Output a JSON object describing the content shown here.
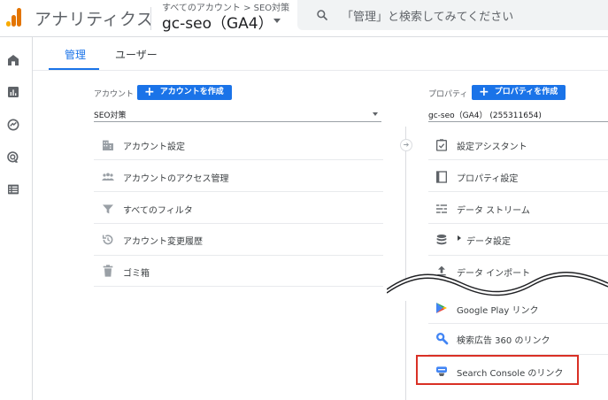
{
  "header": {
    "app_title": "アナリティクス",
    "breadcrumb": "すべてのアカウント > SEO対策",
    "property_title": "gc-seo（GA4）",
    "search_placeholder": "「管理」と検索してみてください"
  },
  "rail": {
    "items": [
      {
        "icon": "home-icon"
      },
      {
        "icon": "reports-icon"
      },
      {
        "icon": "explore-icon"
      },
      {
        "icon": "advertising-icon"
      },
      {
        "icon": "configure-icon"
      }
    ]
  },
  "tabs": [
    {
      "label": "管理",
      "active": true
    },
    {
      "label": "ユーザー",
      "active": false
    }
  ],
  "account": {
    "label": "アカウント",
    "create_button": "アカウントを作成",
    "selected": "SEO対策",
    "items": [
      {
        "label": "アカウント設定",
        "icon": "building-icon"
      },
      {
        "label": "アカウントのアクセス管理",
        "icon": "people-icon"
      },
      {
        "label": "すべてのフィルタ",
        "icon": "filter-icon"
      },
      {
        "label": "アカウント変更履歴",
        "icon": "history-icon"
      },
      {
        "label": "ゴミ箱",
        "icon": "trash-icon"
      }
    ]
  },
  "property": {
    "label": "プロパティ",
    "create_button": "プロパティを作成",
    "selected": "gc-seo（GA4） (255311654)",
    "items": [
      {
        "label": "設定アシスタント",
        "icon": "checklist-icon"
      },
      {
        "label": "プロパティ設定",
        "icon": "property-settings-icon"
      },
      {
        "label": "データ ストリーム",
        "icon": "data-streams-icon"
      },
      {
        "label": "データ設定",
        "icon": "database-icon"
      },
      {
        "label": "データ インポート",
        "icon": "upload-icon"
      },
      {
        "label": "Google Play リンク",
        "icon": "google-play-icon"
      },
      {
        "label": "検索広告 360 のリンク",
        "icon": "search-ads-360-icon"
      },
      {
        "label": "Search Console のリンク",
        "icon": "search-console-icon"
      }
    ]
  },
  "colors": {
    "accent": "#1a73e8",
    "highlight": "#d93025",
    "logo_orange": "#e37400",
    "logo_yellow": "#f9ab00"
  }
}
